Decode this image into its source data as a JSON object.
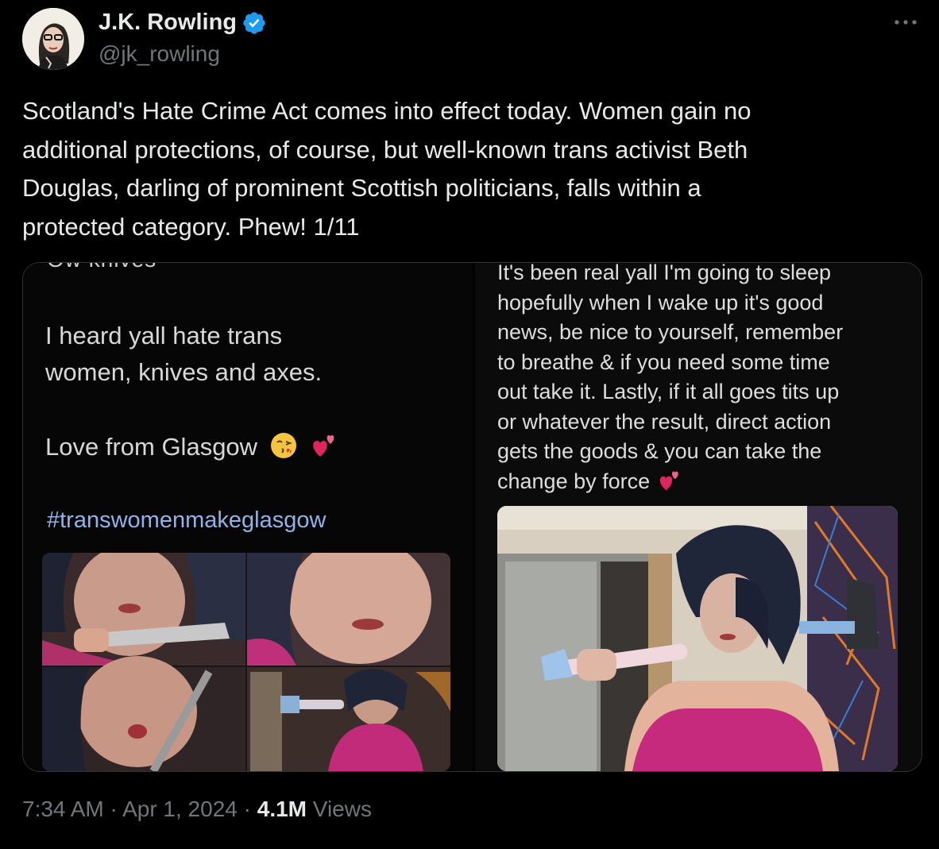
{
  "author": {
    "display_name": "J.K. Rowling",
    "handle": "@jk_rowling",
    "verified_color": "#1d9bf0"
  },
  "tweet": {
    "text": "Scotland's Hate Crime Act comes into effect today. Women gain no\nadditional protections, of course, but well-known trans activist Beth\nDouglas, darling of prominent Scottish politicians, falls within a\nprotected category. Phew! 1/11"
  },
  "media": {
    "left": {
      "cut_top_text": "Ow knives",
      "line1": "I heard yall hate trans",
      "line2": "women, knives and axes.",
      "line3": "Love from Glasgow",
      "hashtag": "#transwomenmakeglasgow"
    },
    "right": {
      "text": "It's been real yall I'm going to sleep\nhopefully when I wake up it's good\nnews, be nice to yourself, remember\nto breathe & if you need some time\nout take it. Lastly, if it all goes tits up\nor whatever the result, direct action\ngets the goods & you can take the\nchange by force"
    }
  },
  "footer": {
    "time": "7:34 AM",
    "separator": "·",
    "date": "Apr 1, 2024",
    "views_count": "4.1M",
    "views_label": "Views"
  },
  "icons": {
    "verified": "verified-badge-icon",
    "more": "more-options-icon",
    "emoji_kiss": "kissing-face-emoji",
    "emoji_hearts": "two-hearts-emoji"
  }
}
